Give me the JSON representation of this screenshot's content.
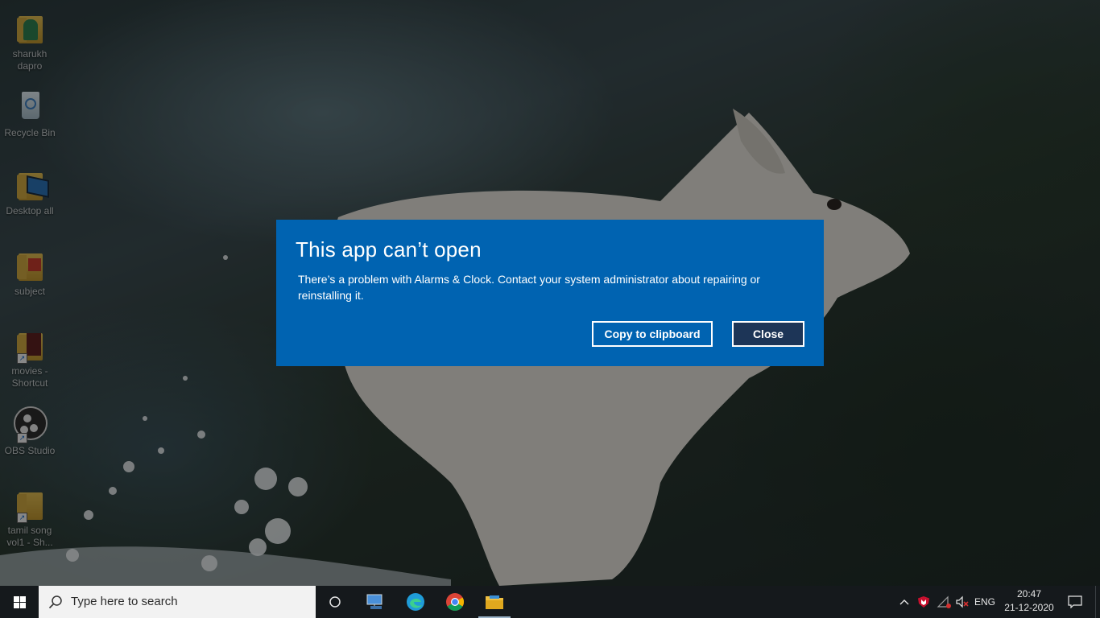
{
  "desktop": {
    "icons": [
      {
        "label": "sharukh\ndapro"
      },
      {
        "label": "Recycle Bin"
      },
      {
        "label": "Desktop all"
      },
      {
        "label": "subject"
      },
      {
        "label": "movies -\nShortcut"
      },
      {
        "label": "OBS Studio"
      },
      {
        "label": "tamil song\nvol1 - Sh..."
      }
    ]
  },
  "dialog": {
    "title": "This app can’t open",
    "message": "There’s a problem with Alarms & Clock. Contact your system administrator about repairing or reinstalling it.",
    "copy_button": "Copy to clipboard",
    "close_button": "Close",
    "background_color": "#0063b1"
  },
  "taskbar": {
    "search_placeholder": "Type here to search",
    "pinned": [
      "task-view-icon",
      "network-pc-icon",
      "edge-icon",
      "chrome-icon",
      "file-explorer-icon"
    ],
    "tray": {
      "language": "ENG",
      "time": "20:47",
      "date": "21-12-2020"
    }
  }
}
